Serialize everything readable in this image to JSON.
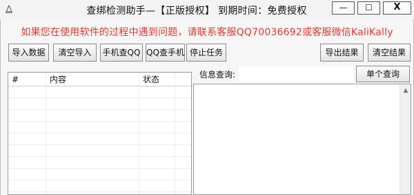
{
  "window": {
    "title": "查绑检测助手—【正版授权】 到期时间：免费授权",
    "min_symbol": "—",
    "max_symbol": "☐",
    "close_symbol": "X"
  },
  "notice": "如果您在使用软件的过程中遇到问题，请联系客服QQ70036692或客服微信KaliKally",
  "toolbar": {
    "import": "导入数据",
    "clear_import": "清空导入",
    "phone_qq": "手机查QQ",
    "qq_phone": "QQ查手机",
    "stop": "停止任务",
    "export": "导出结果",
    "clear_result": "清空结果"
  },
  "table": {
    "columns": [
      "#",
      "内容",
      "状态",
      ""
    ]
  },
  "query": {
    "label": "信息查询:",
    "value": "",
    "button": "单个查询"
  },
  "icons": {
    "app": "app-icon",
    "scroll_up": "chevron-up-icon"
  },
  "colors": {
    "notice": "#d9382f",
    "window_bg": "#f6f6f6"
  }
}
